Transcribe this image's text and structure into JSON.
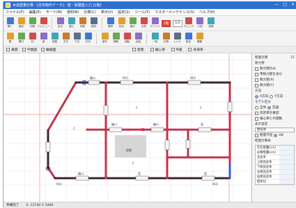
{
  "window": {
    "title": "木造壁量計算 - [住宅物件データ] - 壁・耐震壁入力 [1階]",
    "controls": [
      "—",
      "□",
      "✕"
    ]
  },
  "menu": [
    "ファイル(F)",
    "編集(E)",
    "モード(M)",
    "部材(B)",
    "計算(C)",
    "表示(V)",
    "設定(S)",
    "ツール(T)",
    "マスターメンテナンス(S)",
    "ヘルプ(H)"
  ],
  "toolbar1": {
    "tools": [
      {
        "icon": "folder-icon",
        "label": "開く"
      },
      {
        "icon": "save-icon",
        "label": "保存"
      },
      {
        "icon": "print-icon",
        "label": "印刷"
      },
      {
        "icon": "preview-icon",
        "label": "プレビュー"
      },
      {
        "icon": "undo-icon",
        "label": "戻る"
      },
      {
        "icon": "redo-icon",
        "label": "進む"
      },
      {
        "icon": "cut-icon",
        "label": "切取"
      },
      {
        "icon": "delete-icon",
        "label": "削除"
      },
      {
        "icon": "select-icon",
        "label": "選択"
      },
      {
        "icon": "zoom-in-icon",
        "label": "拡大"
      },
      {
        "icon": "zoom-out-icon",
        "label": "縮小"
      },
      {
        "icon": "fit-icon",
        "label": "全体"
      },
      {
        "icon": "grid-icon",
        "label": "グリッド"
      }
    ],
    "floor_combo": "1階",
    "scale_combo": "1/1",
    "extra_tools": [
      {
        "icon": "check-icon",
        "label": "チェック"
      },
      {
        "icon": "figure-icon",
        "label": "人型"
      },
      {
        "icon": "search-icon",
        "label": "検索"
      }
    ]
  },
  "toolbar2": {
    "tools": [
      {
        "icon": "wall-icon",
        "label": "壁"
      },
      {
        "icon": "opening-icon",
        "label": "開口"
      },
      {
        "icon": "column-icon",
        "label": "柱"
      },
      {
        "icon": "beam-icon",
        "label": "梁"
      },
      {
        "icon": "room-icon",
        "label": "部屋"
      },
      {
        "icon": "text-icon",
        "label": "文字"
      },
      {
        "icon": "dim-icon",
        "label": "寸法"
      },
      {
        "icon": "arrow-icon",
        "label": "矢印"
      },
      {
        "icon": "copy-icon",
        "label": "複写"
      },
      {
        "icon": "move-icon",
        "label": "移動"
      },
      {
        "icon": "rotate-icon",
        "label": "回転"
      },
      {
        "icon": "mirror-icon",
        "label": "反転"
      },
      {
        "icon": "table-icon",
        "label": "一覧"
      },
      {
        "icon": "calc-icon",
        "label": "計算"
      },
      {
        "icon": "layer-icon",
        "label": "レイヤ"
      },
      {
        "icon": "settings-icon",
        "label": "設定"
      },
      {
        "icon": "info-icon",
        "label": "情報"
      }
    ]
  },
  "tabs": {
    "left": [
      "基礎",
      "平面図",
      "軸組図"
    ],
    "right": [
      "壁量",
      "偏心率",
      "N値",
      "床倍率"
    ]
  },
  "canvas": {
    "labels": {
      "opening": "開口",
      "window": "窓",
      "room": "部屋",
      "c_mark": "C",
      "dim": "910"
    }
  },
  "panel": {
    "section1": "壁量計算",
    "item_value": "1F",
    "sub1": "耐力壁",
    "opt1": "耐力壁のみ",
    "opt2": "準耐力壁を含む",
    "opt3": "耐力壁(X)",
    "opt4": "耐力壁(Y)",
    "section2": "方向",
    "radio_x": "X方向",
    "radio_y": "Y方向",
    "section3": "モデル区分",
    "radio_all": "全体",
    "radio_part": "区画",
    "opt_check": "充足率を確認",
    "opt_check2": "偏心率との連動",
    "section4": "表示設定",
    "combo_value": "壁倍率",
    "check_a": "壁量不足",
    "check_b": "OK",
    "table_head": "壁量計算表",
    "table_rows": [
      "存在壁量(cm)",
      "必要壁量(cm)",
      "充足率",
      "上側充足率",
      "下側充足率",
      "左側充足率",
      "右側充足率",
      "壁率比"
    ]
  },
  "status": {
    "left": "準備完了",
    "coords": "X: 12740  Y: 5460"
  }
}
